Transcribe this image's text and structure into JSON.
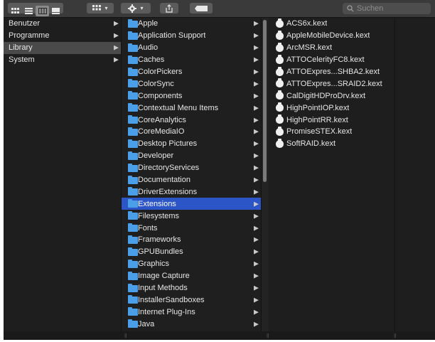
{
  "toolbar": {
    "view_icons": [
      "icon-view-icon",
      "list-view-icon",
      "column-view-icon",
      "gallery-view-icon"
    ],
    "arrange_icon": "arrange-icon",
    "action_icon": "gear-icon",
    "share_icon": "share-icon",
    "tag_icon": "tag-icon"
  },
  "search": {
    "placeholder": "Suchen"
  },
  "column1": {
    "items": [
      {
        "label": "Benutzer"
      },
      {
        "label": "Programme"
      },
      {
        "label": "Library",
        "state": "highlighted"
      },
      {
        "label": "System"
      }
    ]
  },
  "column2": {
    "items": [
      {
        "label": "Apple"
      },
      {
        "label": "Application Support"
      },
      {
        "label": "Audio"
      },
      {
        "label": "Caches"
      },
      {
        "label": "ColorPickers"
      },
      {
        "label": "ColorSync"
      },
      {
        "label": "Components"
      },
      {
        "label": "Contextual Menu Items"
      },
      {
        "label": "CoreAnalytics"
      },
      {
        "label": "CoreMediaIO"
      },
      {
        "label": "Desktop Pictures"
      },
      {
        "label": "Developer"
      },
      {
        "label": "DirectoryServices"
      },
      {
        "label": "Documentation"
      },
      {
        "label": "DriverExtensions"
      },
      {
        "label": "Extensions",
        "state": "selected"
      },
      {
        "label": "Filesystems"
      },
      {
        "label": "Fonts"
      },
      {
        "label": "Frameworks"
      },
      {
        "label": "GPUBundles"
      },
      {
        "label": "Graphics"
      },
      {
        "label": "Image Capture"
      },
      {
        "label": "Input Methods"
      },
      {
        "label": "InstallerSandboxes"
      },
      {
        "label": "Internet Plug-Ins"
      },
      {
        "label": "Java"
      }
    ]
  },
  "column3": {
    "items": [
      {
        "label": "ACS6x.kext"
      },
      {
        "label": "AppleMobileDevice.kext"
      },
      {
        "label": "ArcMSR.kext"
      },
      {
        "label": "ATTOCelerityFC8.kext"
      },
      {
        "label": "ATTOExpres...SHBA2.kext"
      },
      {
        "label": "ATTOExpres...SRAID2.kext"
      },
      {
        "label": "CalDigitHDProDrv.kext"
      },
      {
        "label": "HighPointIOP.kext"
      },
      {
        "label": "HighPointRR.kext"
      },
      {
        "label": "PromiseSTEX.kext"
      },
      {
        "label": "SoftRAID.kext"
      }
    ]
  },
  "colors": {
    "background": "#1e1e1e",
    "selection": "#2c55c8",
    "highlight": "#4a4a4a",
    "folder": "#4a9fe8",
    "text": "#e6e6e6"
  }
}
